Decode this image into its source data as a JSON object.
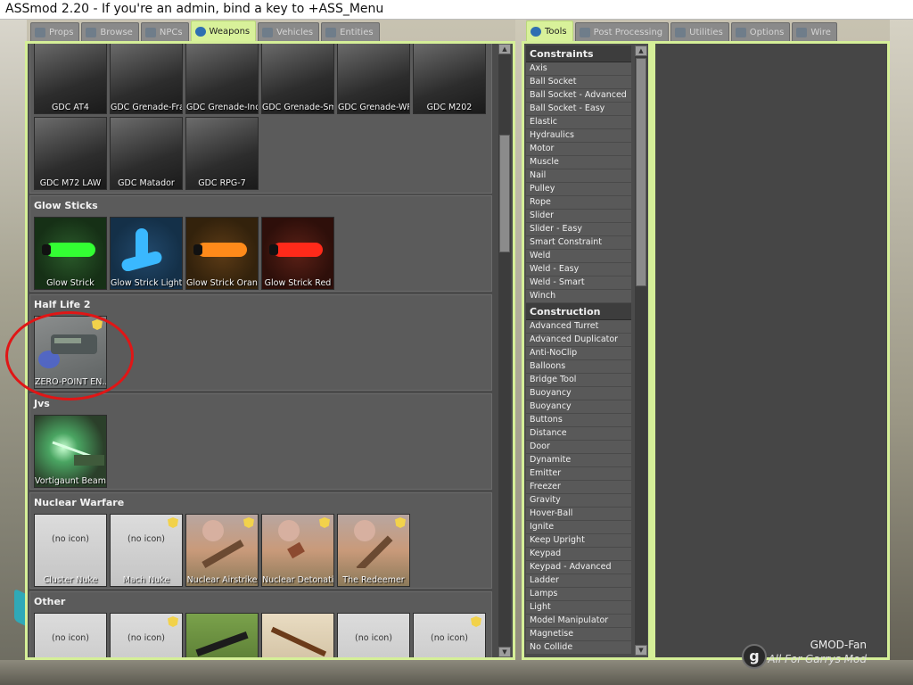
{
  "window": {
    "title": "ASSmod 2.20 - If you're an admin, bind a key to +ASS_Menu"
  },
  "left_tabs": [
    {
      "label": "Props",
      "icon": "props-icon",
      "active": false
    },
    {
      "label": "Browse",
      "icon": "browse-icon",
      "active": false
    },
    {
      "label": "NPCs",
      "icon": "npcs-icon",
      "active": false
    },
    {
      "label": "Weapons",
      "icon": "weapons-icon",
      "active": true
    },
    {
      "label": "Vehicles",
      "icon": "vehicles-icon",
      "active": false
    },
    {
      "label": "Entities",
      "icon": "entities-icon",
      "active": false
    }
  ],
  "right_tabs": [
    {
      "label": "Tools",
      "icon": "wrench-icon",
      "active": true
    },
    {
      "label": "Post Processing",
      "icon": "post-processing-icon",
      "active": false
    },
    {
      "label": "Utilities",
      "icon": "utilities-icon",
      "active": false
    },
    {
      "label": "Options",
      "icon": "options-icon",
      "active": false
    },
    {
      "label": "Wire",
      "icon": "wire-icon",
      "active": false
    }
  ],
  "spawn": {
    "gdc_row1": [
      "GDC AT4",
      "GDC Grenade-Frag",
      "GDC Grenade-Indi...",
      "GDC Grenade-Smo",
      "GDC Grenade-WP",
      "GDC M202"
    ],
    "gdc_row2": [
      "GDC M72 LAW",
      "GDC Matador",
      "GDC RPG-7"
    ],
    "glow": {
      "title": "Glow Sticks",
      "items": [
        "Glow Strick",
        "Glow Strick Light Bl",
        "Glow Strick Orange",
        "Glow Strick Red"
      ]
    },
    "hl2": {
      "title": "Half Life 2",
      "items": [
        "ZERO-POINT EN..."
      ]
    },
    "jvs": {
      "title": "Jvs",
      "items": [
        "Vortigaunt Beam"
      ]
    },
    "nuclear": {
      "title": "Nuclear Warfare",
      "items": [
        "Cluster Nuke",
        "Mach Nuke",
        "Nuclear Airstrike",
        "Nuclear Detonation",
        "The Redeemer"
      ],
      "noicon": "(no icon)"
    },
    "other": {
      "title": "Other",
      "noicon": "(no icon)"
    }
  },
  "tools": {
    "constraints_title": "Constraints",
    "constraints": [
      "Axis",
      "Ball Socket",
      "Ball Socket - Advanced",
      "Ball Socket - Easy",
      "Elastic",
      "Hydraulics",
      "Motor",
      "Muscle",
      "Nail",
      "Pulley",
      "Rope",
      "Slider",
      "Slider - Easy",
      "Smart Constraint",
      "Weld",
      "Weld - Easy",
      "Weld - Smart",
      "Winch"
    ],
    "construction_title": "Construction",
    "construction": [
      "Advanced Turret",
      "Advanced Duplicator",
      "Anti-NoClip",
      "Balloons",
      "Bridge Tool",
      "Buoyancy",
      "Buoyancy",
      "Buttons",
      "Distance",
      "Door",
      "Dynamite",
      "Emitter",
      "Freezer",
      "Gravity",
      "Hover-Ball",
      "Ignite",
      "Keep Upright",
      "Keypad",
      "Keypad - Advanced",
      "Ladder",
      "Lamps",
      "Light",
      "Model Manipulator",
      "Magnetise",
      "No Collide"
    ]
  },
  "watermark": {
    "name": "GMOD-Fan",
    "tagline": "All For Garrys Mod"
  },
  "colors": {
    "accent": "#d5ef98",
    "panel": "#4b4b4b",
    "highlight_circle": "#e01616"
  }
}
